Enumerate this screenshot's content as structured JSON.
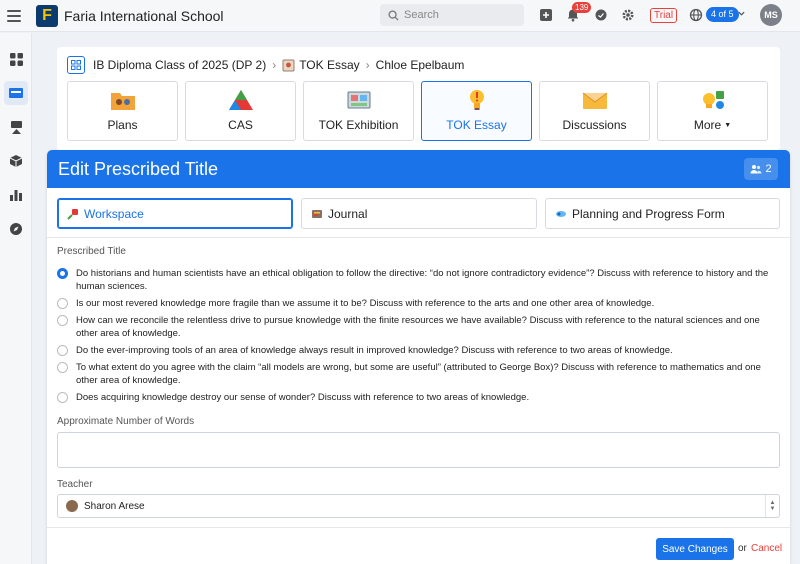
{
  "app": {
    "school_name": "Faria International School",
    "logo_letter": "F",
    "search_placeholder": "Search",
    "notification_count": "139",
    "trial_label": "Trial",
    "page_counter": "4 of 5",
    "user_initials": "MS"
  },
  "breadcrumb": {
    "items": [
      "IB Diploma Class of 2025 (DP 2)",
      "TOK Essay",
      "Chloe Epelbaum"
    ]
  },
  "tabs": [
    {
      "label": "Plans",
      "icon": "folder-people-icon"
    },
    {
      "label": "CAS",
      "icon": "cas-triangle-icon"
    },
    {
      "label": "TOK Exhibition",
      "icon": "exhibition-icon"
    },
    {
      "label": "TOK Essay",
      "icon": "lightbulb-icon"
    },
    {
      "label": "Discussions",
      "icon": "envelope-icon"
    },
    {
      "label": "More",
      "icon": "more-apps-icon"
    }
  ],
  "panel": {
    "title": "Edit Prescribed Title",
    "member_count": "2",
    "subtabs": [
      {
        "label": "Workspace"
      },
      {
        "label": "Journal"
      },
      {
        "label": "Planning and Progress Form"
      }
    ],
    "prescribed_title_label": "Prescribed Title",
    "options": [
      "Do historians and human scientists have an ethical obligation to follow the directive: “do not ignore contradictory evidence”? Discuss with reference to history and the human sciences.",
      "Is our most revered knowledge more fragile than we assume it to be? Discuss with reference to the arts and one other area of knowledge.",
      "How can we reconcile the relentless drive to pursue knowledge with the finite resources we have available? Discuss with reference to the natural sciences and one other area of knowledge.",
      "Do the ever-improving tools of an area of knowledge always result in improved knowledge? Discuss with reference to two areas of knowledge.",
      "To what extent do you agree with the claim “all models are wrong, but some are useful” (attributed to George Box)? Discuss with reference to mathematics and one other area of knowledge.",
      "Does acquiring knowledge destroy our sense of wonder? Discuss with reference to two areas of knowledge."
    ],
    "selected_option": 0,
    "words_label": "Approximate Number of Words",
    "words_value": "",
    "teacher_label": "Teacher",
    "teacher_value": "Sharon Arese",
    "save_label": "Save Changes",
    "or_label": "or",
    "cancel_label": "Cancel"
  },
  "colors": {
    "accent": "#1a73e8",
    "danger": "#e8413c"
  }
}
